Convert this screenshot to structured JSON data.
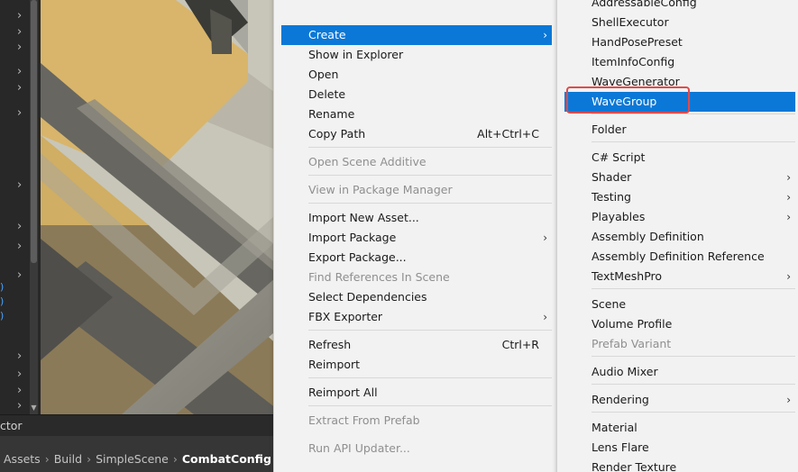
{
  "left_panel": {
    "chevron_glyph": "›",
    "blue_fragments": [
      ")",
      ")",
      ")"
    ],
    "scroll_down_glyph": "▼"
  },
  "bottom_bar": {
    "tab_label": "ctor",
    "breadcrumb": [
      "Assets",
      "Build",
      "SimpleScene",
      "CombatConfig"
    ],
    "separator_glyph": "›"
  },
  "context_menu": {
    "arrow_glyph": "›",
    "items": [
      {
        "label": "Create",
        "highlighted": true,
        "submenu": true
      },
      {
        "label": "Show in Explorer"
      },
      {
        "label": "Open"
      },
      {
        "label": "Delete"
      },
      {
        "label": "Rename"
      },
      {
        "label": "Copy Path",
        "shortcut": "Alt+Ctrl+C"
      },
      {
        "label": "Open Scene Additive",
        "disabled": true
      },
      {
        "label": "View in Package Manager",
        "disabled": true
      },
      {
        "label": "Import New Asset..."
      },
      {
        "label": "Import Package",
        "submenu": true
      },
      {
        "label": "Export Package..."
      },
      {
        "label": "Find References In Scene",
        "disabled": true
      },
      {
        "label": "Select Dependencies"
      },
      {
        "label": "FBX Exporter",
        "submenu": true
      },
      {
        "label": "Refresh",
        "shortcut": "Ctrl+R"
      },
      {
        "label": "Reimport"
      },
      {
        "label": "Reimport All"
      },
      {
        "label": "Extract From Prefab",
        "disabled": true
      },
      {
        "label": "Run API Updater...",
        "disabled": true
      }
    ]
  },
  "create_submenu": {
    "items": [
      {
        "label": "AddressableConfig"
      },
      {
        "label": "ShellExecutor"
      },
      {
        "label": "HandPosePreset"
      },
      {
        "label": "ItemInfoConfig"
      },
      {
        "label": "WaveGenerator"
      },
      {
        "label": "WaveGroup",
        "highlighted": true,
        "annotated": true
      },
      {
        "label": "Folder"
      },
      {
        "label": "C# Script"
      },
      {
        "label": "Shader",
        "submenu": true
      },
      {
        "label": "Testing",
        "submenu": true
      },
      {
        "label": "Playables",
        "submenu": true
      },
      {
        "label": "Assembly Definition"
      },
      {
        "label": "Assembly Definition Reference"
      },
      {
        "label": "TextMeshPro",
        "submenu": true
      },
      {
        "label": "Scene"
      },
      {
        "label": "Volume Profile"
      },
      {
        "label": "Prefab Variant",
        "disabled": true
      },
      {
        "label": "Audio Mixer"
      },
      {
        "label": "Rendering",
        "submenu": true
      },
      {
        "label": "Material"
      },
      {
        "label": "Lens Flare"
      },
      {
        "label": "Render Texture"
      }
    ]
  },
  "colors": {
    "highlight": "#0b78d7",
    "annotation": "#e04a4a",
    "menu_bg": "#f2f2f2",
    "disabled_text": "#8f8f8f"
  }
}
